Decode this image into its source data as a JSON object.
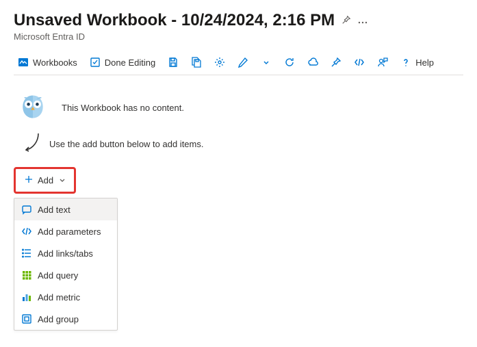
{
  "header": {
    "title": "Unsaved Workbook - 10/24/2024, 2:16 PM",
    "subtitle": "Microsoft Entra ID"
  },
  "toolbar": {
    "workbooks": "Workbooks",
    "done_editing": "Done Editing",
    "help": "Help"
  },
  "empty_state": {
    "message": "This Workbook has no content.",
    "hint": "Use the add button below to add items."
  },
  "add_button": {
    "label": "Add"
  },
  "dropdown": {
    "items": [
      {
        "label": "Add text"
      },
      {
        "label": "Add parameters"
      },
      {
        "label": "Add links/tabs"
      },
      {
        "label": "Add query"
      },
      {
        "label": "Add metric"
      },
      {
        "label": "Add group"
      }
    ]
  }
}
